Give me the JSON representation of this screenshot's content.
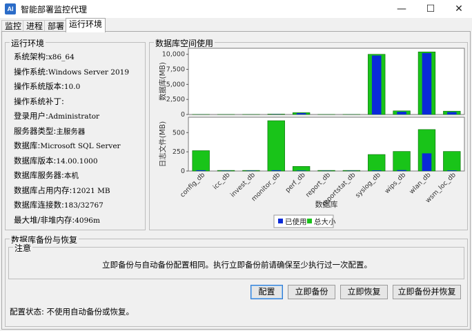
{
  "window": {
    "title": "智能部署监控代理",
    "icon": "app-icon",
    "controls": [
      "minimize",
      "maximize",
      "close"
    ]
  },
  "tabs": [
    {
      "label": "监控",
      "active": false
    },
    {
      "label": "进程",
      "active": false
    },
    {
      "label": "部署",
      "active": false
    },
    {
      "label": "运行环境",
      "active": true
    }
  ],
  "runtime": {
    "group_title": "运行环境",
    "items": [
      {
        "label": "系统架构:",
        "value": "x86_64"
      },
      {
        "label": "操作系统:",
        "value": "Windows Server 2019"
      },
      {
        "label": "操作系统版本:",
        "value": "10.0"
      },
      {
        "label": "操作系统补丁:",
        "value": ""
      },
      {
        "label": "登录用户:",
        "value": "Administrator"
      },
      {
        "label": "服务器类型:",
        "value": "主服务器"
      },
      {
        "label": "数据库:",
        "value": "Microsoft SQL Server"
      },
      {
        "label": "数据库版本:",
        "value": "14.00.1000"
      },
      {
        "label": "数据库服务器:",
        "value": "本机"
      },
      {
        "label": "数据库占用内存:",
        "value": "12021 MB"
      },
      {
        "label": "数据库连接数:",
        "value": "183/32767"
      },
      {
        "label": "最大堆/非堆内存:",
        "value": "4096m"
      }
    ]
  },
  "db_space": {
    "group_title": "数据库空间使用"
  },
  "chart_data": [
    {
      "type": "bar",
      "ylabel": "数据库(MB)",
      "ylim": [
        0,
        11000
      ],
      "yticks": [
        "0",
        "2,500",
        "5,000",
        "7,500",
        "10,000"
      ],
      "yticks_values": [
        0,
        2500,
        5000,
        7500,
        10000
      ],
      "categories": [
        "config_db",
        "icc_db",
        "invest_db",
        "monitor_db",
        "perf_db",
        "report_db",
        "reportstat_db",
        "syslog_db",
        "wips_db",
        "wlan_db",
        "wsm_loc_db"
      ],
      "series": [
        {
          "name": "已使用",
          "color": "#0a2ad8",
          "values": [
            8,
            5,
            5,
            30,
            220,
            5,
            8,
            9800,
            450,
            10200,
            400
          ]
        },
        {
          "name": "总大小",
          "color": "#19c419",
          "values": [
            10,
            8,
            8,
            64,
            300,
            8,
            10,
            10000,
            600,
            10400,
            550
          ]
        }
      ]
    },
    {
      "type": "bar",
      "ylabel": "日志文件(MB)",
      "ylim": [
        0,
        700
      ],
      "yticks": [
        "0",
        "250",
        "500"
      ],
      "yticks_values": [
        0,
        250,
        500
      ],
      "xlabel": "数据库",
      "categories": [
        "config_db",
        "icc_db",
        "invest_db",
        "monitor_db",
        "perf_db",
        "report_db",
        "reportstat_db",
        "syslog_db",
        "wips_db",
        "wlan_db",
        "wsm_loc_db"
      ],
      "series": [
        {
          "name": "已使用",
          "color": "#0a2ad8",
          "values": [
            10,
            4,
            4,
            10,
            6,
            3,
            3,
            8,
            12,
            230,
            8
          ]
        },
        {
          "name": "总大小",
          "color": "#19c419",
          "values": [
            265,
            8,
            8,
            655,
            60,
            8,
            8,
            215,
            255,
            540,
            255
          ]
        }
      ]
    }
  ],
  "legend": {
    "items": [
      {
        "label": "已使用",
        "color": "#0a2ad8"
      },
      {
        "label": "总大小",
        "color": "#19c419"
      }
    ]
  },
  "backup": {
    "group_title": "数据库备份与恢复",
    "note_title": "注意",
    "note_text": "立即备份与自动备份配置相同。执行立即备份前请确保至少执行过一次配置。",
    "buttons": {
      "config": "配置",
      "backup_now": "立即备份",
      "restore_now": "立即恢复",
      "backup_and_restore": "立即备份并恢复"
    },
    "status_label": "配置状态:",
    "status_value": "不使用自动备份或恢复。"
  }
}
